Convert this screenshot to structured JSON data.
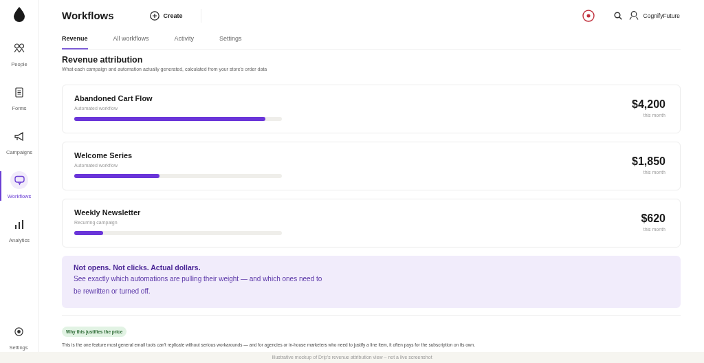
{
  "sidebar": {
    "items": [
      {
        "label": "People",
        "selected": false
      },
      {
        "label": "Forms",
        "selected": false
      },
      {
        "label": "Campaigns",
        "selected": false
      },
      {
        "label": "Workflows",
        "selected": true
      },
      {
        "label": "Analytics",
        "selected": false
      }
    ],
    "bottom_item": {
      "label": "Settings"
    }
  },
  "header": {
    "title": "Workflows",
    "create_button": "Create",
    "user": "CognifyFuture"
  },
  "tabs": [
    {
      "label": "Revenue",
      "selected": true
    },
    {
      "label": "All workflows",
      "selected": false
    },
    {
      "label": "Activity",
      "selected": false
    },
    {
      "label": "Settings",
      "selected": false
    }
  ],
  "section": {
    "title": "Revenue attribution",
    "subtitle": "What each campaign and automation actually generated, calculated from your store's order data"
  },
  "cards": [
    {
      "name": "Abandoned Cart Flow",
      "type": "Automated workflow",
      "level": 0.92,
      "amount": "$4,200",
      "period": "this month"
    },
    {
      "name": "Welcome Series",
      "type": "Automated workflow",
      "level": 0.41,
      "amount": "$1,850",
      "period": "this month"
    },
    {
      "name": "Weekly Newsletter",
      "type": "Recurring campaign",
      "level": 0.14,
      "amount": "$620",
      "period": "this month"
    }
  ],
  "callout": {
    "headline": "Not opens. Not clicks. Actual dollars.",
    "body": "See exactly which automations are pulling their weight — and which ones need to be rewritten or turned off."
  },
  "badge": "Why this justifies the price",
  "note": "This is the one feature most general email tools can't replicate without serious workarounds — and for agencies or in-house marketers who need to justify a line item, it often pays for the subscription on its own.",
  "caption": "Illustrative mockup of Drip's revenue attribution view – not a live screenshot"
}
